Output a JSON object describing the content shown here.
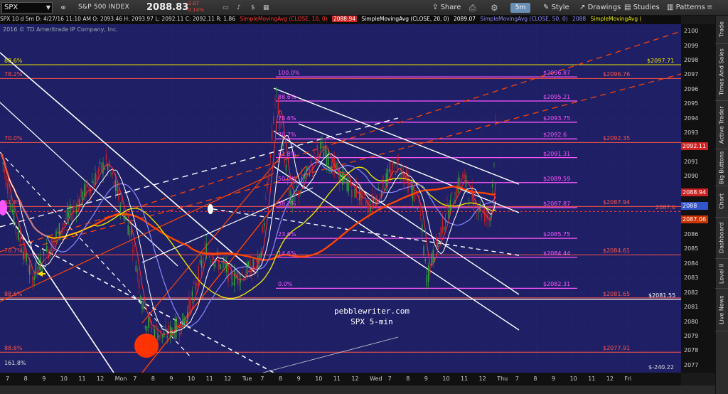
{
  "toolbar": {
    "symbol": "SPX",
    "index_name": "S&P 500 INDEX",
    "last_price": "2088.83",
    "change": "-2.87",
    "change_pct": "-0.14%",
    "share_label": "Share",
    "interval_label": "5m",
    "style_label": "Style",
    "drawings_label": "Drawings",
    "studies_label": "Studies",
    "patterns_label": "Patterns"
  },
  "sub_header": {
    "bar_info": "SPX 10 d 5m  D: 4/27/16 11:10 AM  O: 2093.46  H: 2093.97  L: 2092.11  C: 2092.11  R: 1.86",
    "sma10": "SimpleMovingAvg (CLOSE, 10, 0)",
    "sma10_val": "2088.94",
    "sma20": "SimpleMovingAvg (CLOSE, 20, 0)",
    "sma20_val": "2089.07",
    "sma50": "SimpleMovingAvg (CLOSE, 50, 0)",
    "sma50_val": "2088",
    "sma_extra": "SimpleMovingAvg ("
  },
  "copyright": "2016 © TD Ameritrade IP Company, Inc.",
  "watermark": {
    "site": "pebblewriter.com",
    "caption": "SPX 5-min"
  },
  "colors": {
    "background": "#1f1f66",
    "sma10": "#ff3333",
    "sma20": "#ffffff",
    "sma50": "#8888ff",
    "sma_long": "#ff4400",
    "yellow_ma": "#e6e600",
    "fib_magenta": "#ff55ff",
    "fib_red": "#ff5544",
    "candle_up": "#33aa33",
    "candle_down": "#cc2222"
  },
  "price_axis": {
    "ticks": [
      "2100",
      "2099",
      "2098",
      "2097",
      "2096",
      "2095",
      "2094",
      "2093",
      "2092",
      "2091",
      "2090",
      "2089",
      "2088",
      "2087",
      "2086",
      "2085",
      "2084",
      "2083",
      "2082",
      "2081",
      "2080",
      "2079",
      "2078",
      "2077"
    ],
    "badges": [
      {
        "value": "2092.11",
        "color": "#cc2222"
      },
      {
        "value": "2088.94",
        "color": "#cc2222"
      },
      {
        "value": "2088",
        "color": "#3355cc"
      },
      {
        "value": "2087.06",
        "color": "#cc3300"
      }
    ]
  },
  "time_axis": {
    "ticks": [
      "7",
      "8",
      "9",
      "10",
      "11",
      "12",
      "Mon",
      "7",
      "8",
      "9",
      "10",
      "11",
      "12",
      "Tue",
      "7",
      "8",
      "9",
      "10",
      "11",
      "12",
      "Wed",
      "7",
      "8",
      "9",
      "10",
      "11",
      "12",
      "Thu",
      "7",
      "8",
      "9",
      "10",
      "11",
      "12",
      "Fri"
    ]
  },
  "fib_levels_magenta": [
    {
      "pct": "100.0%",
      "value": "$2096.87"
    },
    {
      "pct": "88.6%",
      "value": "$2095.21"
    },
    {
      "pct": "78.6%",
      "value": "$2093.75"
    },
    {
      "pct": "70.7%",
      "value": "$2092.6"
    },
    {
      "pct": "61.8%",
      "value": "$2091.31"
    },
    {
      "pct": "50.0%",
      "value": "$2089.59"
    },
    {
      "pct": "38.2%",
      "value": "$2087.87"
    },
    {
      "pct": "23.6%",
      "value": "$2085.75"
    },
    {
      "pct": "14.6%",
      "value": "$2084.44"
    },
    {
      "pct": "0.0%",
      "value": "$2082.31"
    }
  ],
  "fib_levels_red": [
    {
      "pct": "88.6%",
      "value": "$2097.71"
    },
    {
      "pct": "78.2%",
      "value": "$2096.76"
    },
    {
      "pct": "70.0%",
      "value": "$2092.35"
    },
    {
      "pct": "61.8%",
      "value": "$2087.94"
    },
    {
      "pct": "70.7%",
      "value": "$2084.61"
    },
    {
      "pct": "88.6%",
      "value": "$2081.65"
    },
    {
      "pct": "88.6%",
      "value": "$2077.91"
    },
    {
      "pct": "161.8%",
      "value": ""
    }
  ],
  "misc_labels": {
    "level_2087_6": "2087.6",
    "level_2081_55": "$2081.55",
    "bottom_right": "$-240.22"
  },
  "side_tabs": [
    "Trade",
    "Times And Sales",
    "Active Trader",
    "Big Buttons",
    "Chart",
    "Dashboard",
    "Level II",
    "Live News"
  ]
}
